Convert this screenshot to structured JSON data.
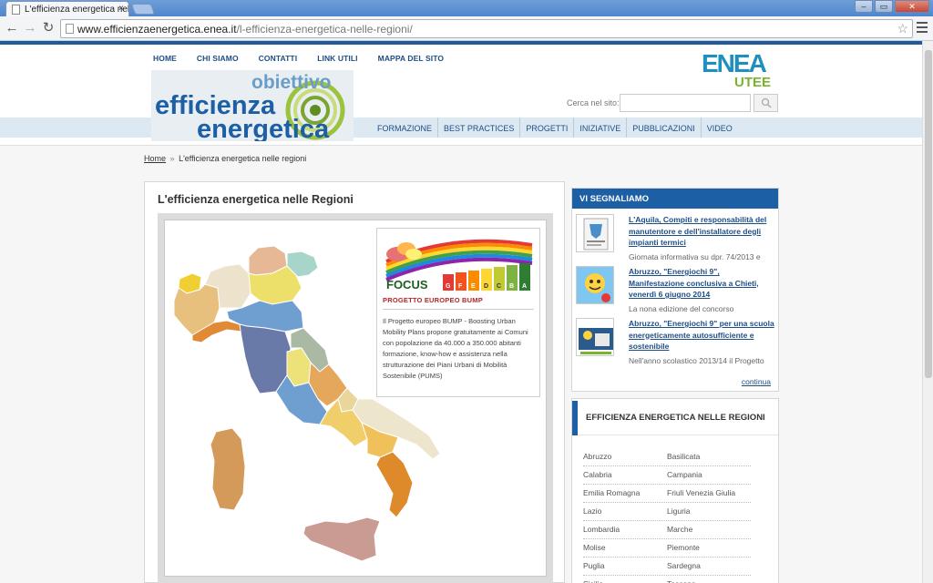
{
  "browser": {
    "tab_title": "L'efficienza energetica nelle r",
    "tab_close": "×",
    "url_host": "www.efficienzaenergetica.enea.it",
    "url_path": "/l-efficienza-energetica-nelle-regioni/",
    "back": "←",
    "forward": "→",
    "reload": "↻",
    "star": "☆",
    "min": "–",
    "max": "▭",
    "close": "✕"
  },
  "header": {
    "topnav": [
      "HOME",
      "CHI SIAMO",
      "CONTATTI",
      "LINK UTILI",
      "MAPPA DEL SITO"
    ],
    "logo_line1": "obiettivo",
    "logo_line2": "efficienza",
    "logo_line3": "energetica",
    "enea_line1": "ENEA",
    "enea_line2": "UTEE",
    "search_label": "Cerca nel sito:",
    "search_placeholder": "",
    "mainmenu": [
      "FORMAZIONE",
      "BEST PRACTICES",
      "PROGETTI",
      "INIZIATIVE",
      "PUBBLICAZIONI",
      "VIDEO"
    ]
  },
  "breadcrumb": {
    "home": "Home",
    "sep": "»",
    "current": "L'efficienza energetica nelle regioni"
  },
  "content": {
    "title": "L'efficienza energetica nelle Regioni",
    "focus": {
      "logo": "FOCUS",
      "scale": [
        "G",
        "F",
        "E",
        "D",
        "C",
        "B",
        "A"
      ],
      "title": "PROGETTO EUROPEO BUMP",
      "text": "Il Progetto europeo BUMP - Boosting Urban Mobility Plans propone gratuitamente ai Comuni con popolazione da 40.000 a 350.000 abitanti formazione, know-how e assistenza nella strutturazione dei Piani Urbani di Mobilità Sostenibile (PUMS)"
    }
  },
  "sidebar": {
    "signal_title": "VI SEGNALIAMO",
    "news": [
      {
        "title": "L'Aquila, Compiti e responsabilità del manutentore e dell'installatore degli impianti termici",
        "sub": "Giornata informativa su dpr. 74/2013 e"
      },
      {
        "title": "Abruzzo, \"Energiochi 9\", Manifestazione conclusiva a Chieti, venerdì 6 giugno 2014",
        "sub": "La nona edizione del concorso"
      },
      {
        "title": "Abruzzo, \"Energiochi 9\" per una scuola energeticamente autosufficiente e sostenibile",
        "sub": "Nell'anno scolastico 2013/14 il Progetto"
      }
    ],
    "continua": "continua",
    "regions_title": "EFFICIENZA ENERGETICA NELLE REGIONI",
    "regions": [
      [
        "Abruzzo",
        "Basilicata"
      ],
      [
        "Calabria",
        "Campania"
      ],
      [
        "Emilia Romagna",
        "Friuli Venezia Giulia"
      ],
      [
        "Lazio",
        "Liguria"
      ],
      [
        "Lombardia",
        "Marche"
      ],
      [
        "Molise",
        "Piemonte"
      ],
      [
        "Puglia",
        "Sardegna"
      ],
      [
        "Sicilia",
        "Toscana"
      ]
    ]
  },
  "colors": {
    "brand_blue": "#1d5fa5",
    "link_blue": "#1d4e86",
    "enea_teal": "#1f8fbf",
    "enea_green": "#7ab32e"
  }
}
